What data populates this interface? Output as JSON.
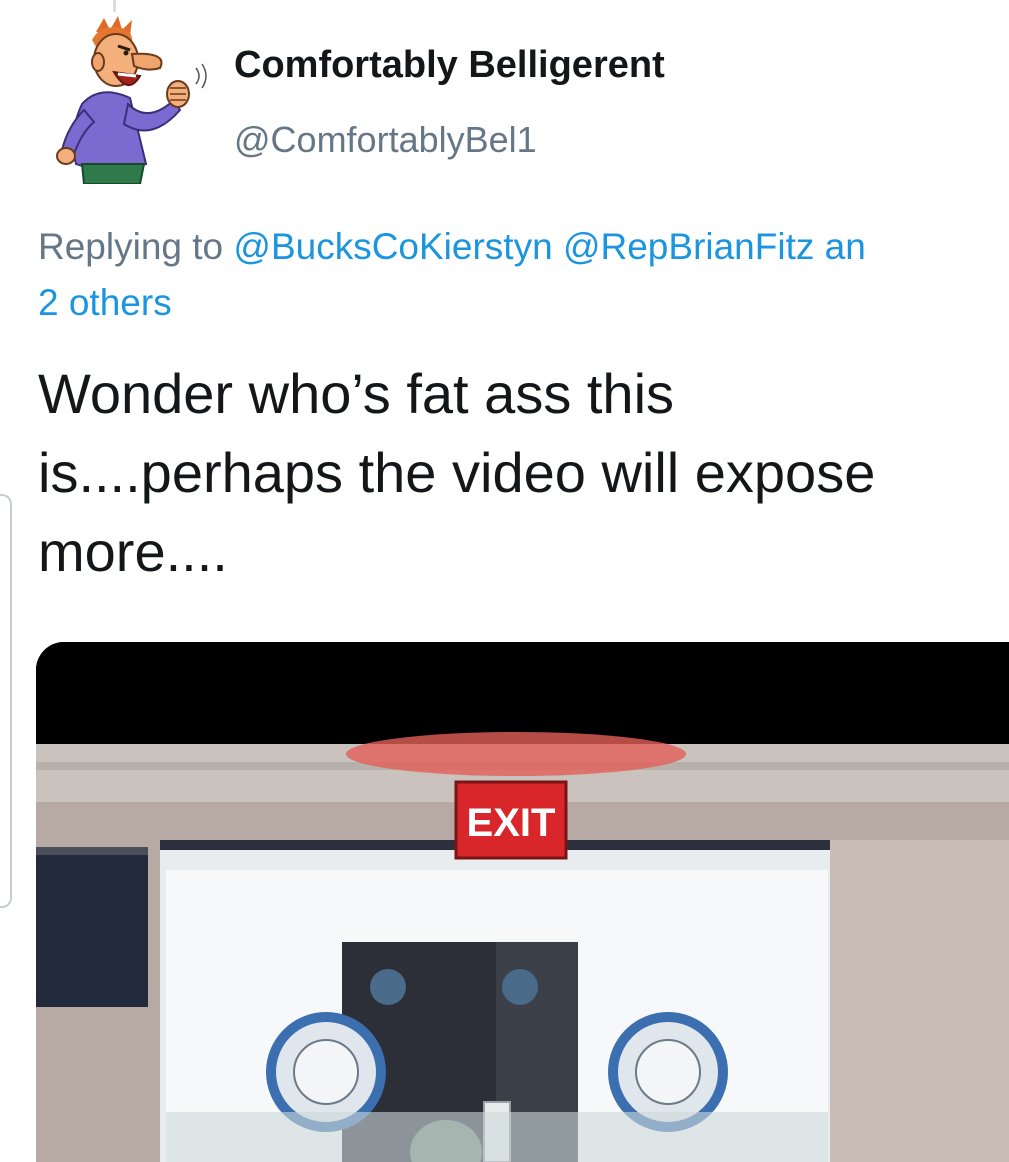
{
  "tweet": {
    "author": {
      "display_name": "Comfortably Belligerent",
      "handle": "@ComfortablyBel1",
      "avatar_icon": "angry-cartoon-man-avatar"
    },
    "reply": {
      "prefix": "Replying to",
      "mentions": [
        "@BucksCoKierstyn",
        "@RepBrianFitz",
        "an"
      ],
      "others": "2 others"
    },
    "text_lines": [
      "Wonder who’s fat ass this",
      "is....perhaps the video will expose",
      "more...."
    ],
    "media": {
      "type": "video-still",
      "sign_text": "EXIT"
    }
  },
  "colors": {
    "text": "#14171a",
    "secondary": "#657786",
    "link": "#1b95e0",
    "exit_sign": "#d8262a"
  }
}
